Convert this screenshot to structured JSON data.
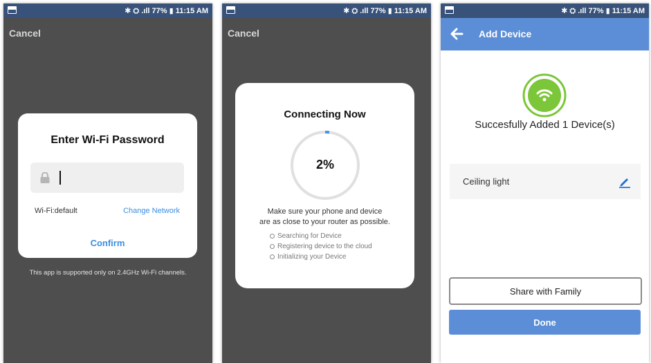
{
  "status_bar": {
    "text": "✱ ⛭ .ıll 77% ▮ 11:15 AM"
  },
  "screen1": {
    "cancel": "Cancel",
    "dialog_title": "Enter Wi-Fi Password",
    "password_value": "",
    "wifi_label": "Wi-Fi:default",
    "change_network": "Change Network",
    "confirm": "Confirm",
    "note": "This app is supported only on 2.4GHz Wi-Fi channels."
  },
  "screen2": {
    "cancel": "Cancel",
    "dialog_title": "Connecting Now",
    "progress_label": "2%",
    "progress": 0.02,
    "message_line1": "Make sure your phone and device",
    "message_line2": "are as close to your router as possible.",
    "steps": [
      "Searching for Device",
      "Registering device to the cloud",
      "Initializing your Device"
    ]
  },
  "screen3": {
    "title": "Add Device",
    "success_text": "Succesfully Added 1 Device(s)",
    "device_name": "Ceiling light",
    "share_button": "Share with Family",
    "done_button": "Done"
  },
  "colors": {
    "status_bar": "#38527a",
    "overlay": "#4e4e4e",
    "accent_blue": "#3a8ee0",
    "app_bar": "#5b8ed6",
    "success_green": "#7cc63a"
  },
  "icons": [
    "gallery-icon",
    "lock-icon",
    "back-arrow-icon",
    "wifi-icon",
    "edit-pencil-icon"
  ]
}
